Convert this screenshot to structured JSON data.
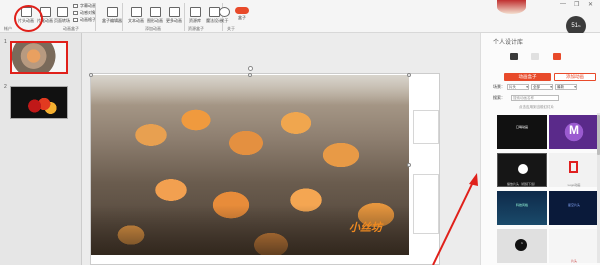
{
  "ribbon": {
    "buttons": [
      {
        "label": "片头动画"
      },
      {
        "label": "片尾动画"
      },
      {
        "label": "页面转场"
      }
    ],
    "small": [
      {
        "label": "字幕动画"
      },
      {
        "label": "动感对象"
      },
      {
        "label": "动画格子"
      }
    ],
    "tools": [
      {
        "label": "盒子编辑器"
      },
      {
        "label": "文本动画"
      },
      {
        "label": "图形动画"
      },
      {
        "label": "更多动画"
      },
      {
        "label": "资源库"
      },
      {
        "label": "魔法设计"
      },
      {
        "label": "关于"
      },
      {
        "label": "盒子"
      }
    ],
    "groups": [
      {
        "label": "帐户"
      },
      {
        "label": "动画盒子"
      },
      {
        "label": "添加动画"
      },
      {
        "label": "资源盒子"
      },
      {
        "label": "关于"
      }
    ]
  },
  "topright": {
    "user": "个人设计库",
    "speed": "51",
    "speed_unit": "%"
  },
  "thumbnails": [
    {
      "num": "1"
    },
    {
      "num": "2"
    }
  ],
  "canvas": {
    "watermark": "小丝坊"
  },
  "library": {
    "title": "个人设计库",
    "tabs": {
      "active": "动画盒子",
      "inactive": "添加动画"
    },
    "filters": {
      "label1": "场景：",
      "scene": "片头",
      "category": "全部",
      "sort": "最新"
    },
    "search": {
      "label": "搜索：",
      "placeholder": "搜索动画名称"
    },
    "category_label": "点击应用到当前幻灯片",
    "cards": [
      {
        "caption": "口哨动画",
        "bg": "#111111"
      },
      {
        "caption": "M",
        "bg": "#5a2a8a"
      },
      {
        "caption": "播放片头（视频下载）",
        "bg": "#161616"
      },
      {
        "caption": "Logo动画",
        "bg": "#f2f2f2"
      },
      {
        "caption": "科技风格",
        "bg": "#0e2a4a"
      },
      {
        "caption": "星空片头",
        "bg": "#0a1a3a"
      },
      {
        "caption": "1",
        "bg": "#e0e0e0"
      },
      {
        "caption": "片头",
        "bg": "#f5f5f5"
      }
    ]
  },
  "colors": {
    "accent": "#e84a2a",
    "annotation": "#e0201a"
  }
}
